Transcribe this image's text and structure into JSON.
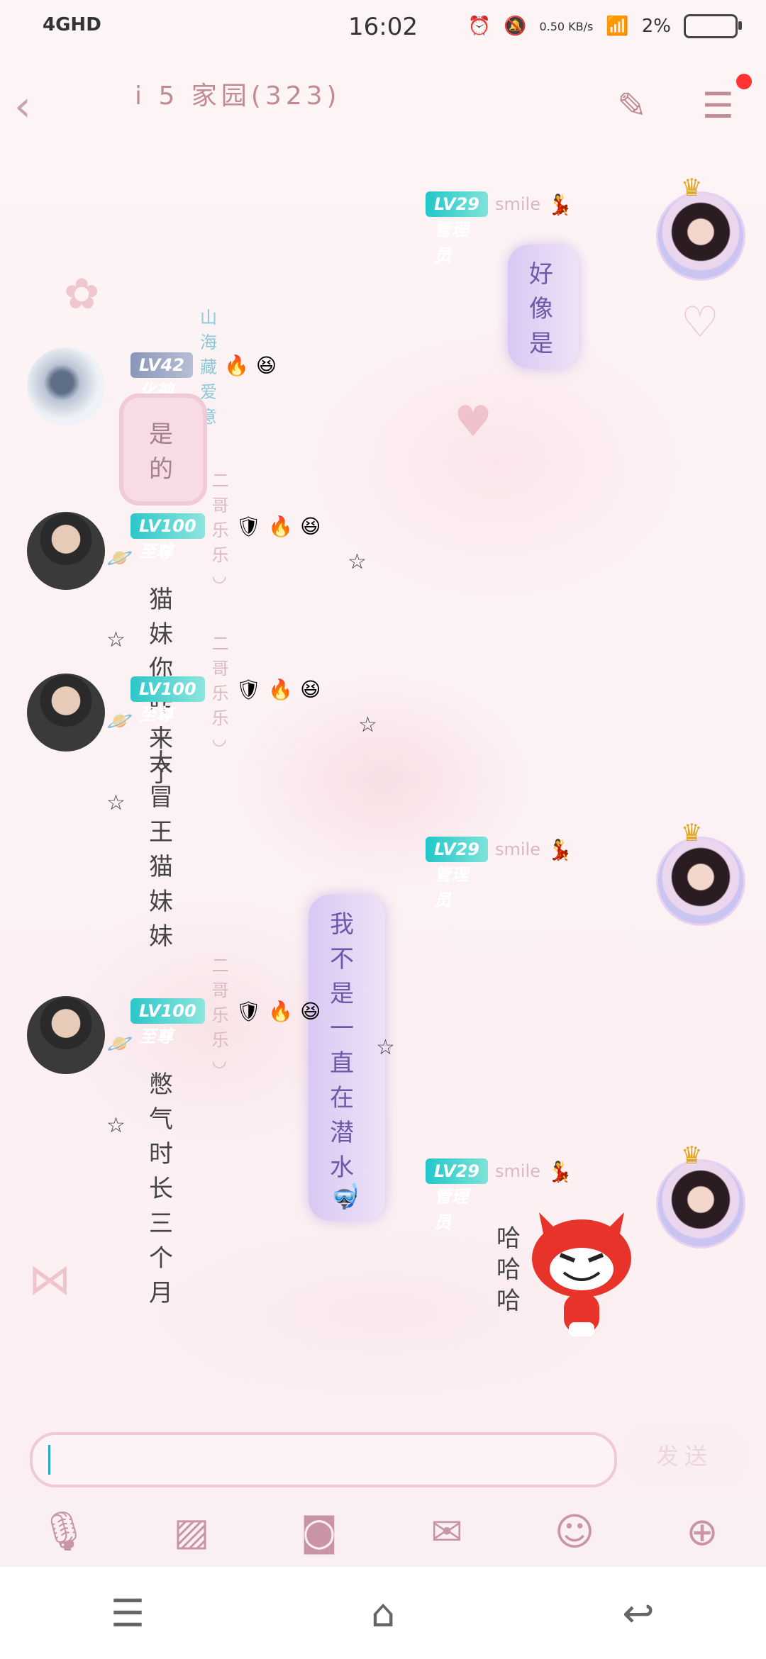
{
  "status": {
    "network": "4GHD",
    "time": "16:02",
    "speed": "0.50 KB/s",
    "battery": "2%"
  },
  "header": {
    "title": "i 5  家园(323)",
    "back_icon": "back-icon",
    "edit_icon": "edit-icon",
    "menu_icon": "menu-icon"
  },
  "messages": [
    {
      "side": "right",
      "level": "LV29 管理员",
      "nick": "smile",
      "text": "好像是"
    },
    {
      "side": "left",
      "level": "LV42 化神",
      "nick": "山海藏爱意",
      "text": "是的"
    },
    {
      "side": "left",
      "level": "LV100 至尊",
      "nick": "二哥乐乐◡",
      "text": "猫妹你咋来了"
    },
    {
      "side": "left",
      "level": "LV100 至尊",
      "nick": "二哥乐乐◡",
      "text": "太冒王猫妹妹"
    },
    {
      "side": "right",
      "level": "LV29 管理员",
      "nick": "smile",
      "text": "我不是一直在潜水"
    },
    {
      "side": "left",
      "level": "LV100 至尊",
      "nick": "二哥乐乐◡",
      "text": "憋气时长三个月"
    },
    {
      "side": "right",
      "level": "LV29 管理员",
      "nick": "smile",
      "text": "哈哈哈"
    }
  ],
  "composer": {
    "send_label": "发送"
  },
  "colors": {
    "accent": "#c995a4",
    "level_teal": "#21c7c9"
  }
}
